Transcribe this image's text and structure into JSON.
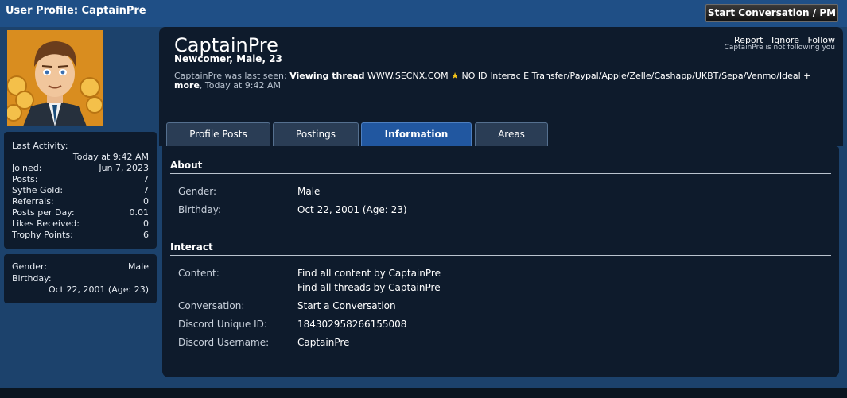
{
  "header": {
    "page_title": "User Profile: CaptainPre",
    "start_conversation_label": "Start Conversation / PM"
  },
  "sidebar": {
    "stats": {
      "last_activity_label": "Last Activity:",
      "last_activity_value": "Today at 9:42 AM",
      "items": [
        {
          "label": "Joined:",
          "value": "Jun 7, 2023"
        },
        {
          "label": "Posts:",
          "value": "7"
        },
        {
          "label": "Sythe Gold:",
          "value": "7"
        },
        {
          "label": "Referrals:",
          "value": "0"
        },
        {
          "label": "Posts per Day:",
          "value": "0.01"
        },
        {
          "label": "Likes Received:",
          "value": "0"
        },
        {
          "label": "Trophy Points:",
          "value": "6"
        }
      ]
    },
    "info": {
      "gender_label": "Gender:",
      "gender_value": "Male",
      "birthday_label": "Birthday:",
      "birthday_value": "Oct 22, 2001 (Age: 23)"
    }
  },
  "profile": {
    "username": "CaptainPre",
    "user_title": "Newcomer, Male, 23",
    "last_seen_prefix": "CaptainPre was last seen:",
    "last_seen_action": "Viewing thread",
    "last_seen_thread_a": "WWW.SECNX.COM",
    "last_seen_thread_b": "NO ID Interac E Transfer/Paypal/Apple/Zelle/Cashapp/UKBT/Sepa/Venmo/Ideal +",
    "last_seen_thread_c": "more",
    "last_seen_time": ", Today at 9:42 AM",
    "links": {
      "report": "Report",
      "ignore": "Ignore",
      "follow": "Follow"
    },
    "follow_status": "CaptainPre is not following you"
  },
  "tabs": [
    {
      "label": "Profile Posts",
      "active": false
    },
    {
      "label": "Postings",
      "active": false
    },
    {
      "label": "Information",
      "active": true
    },
    {
      "label": "Areas",
      "active": false
    }
  ],
  "about": {
    "title": "About",
    "gender_label": "Gender:",
    "gender_value": "Male",
    "birthday_label": "Birthday:",
    "birthday_value": "Oct 22, 2001 (Age: 23)"
  },
  "interact": {
    "title": "Interact",
    "content_label": "Content:",
    "content_link1": "Find all content by CaptainPre",
    "content_link2": "Find all threads by CaptainPre",
    "conversation_label": "Conversation:",
    "conversation_value": "Start a Conversation",
    "discord_id_label": "Discord Unique ID:",
    "discord_id_value": "184302958266155008",
    "discord_user_label": "Discord Username:",
    "discord_user_value": "CaptainPre"
  },
  "icons": {
    "star": "star-icon",
    "avatar": "avatar-image"
  }
}
